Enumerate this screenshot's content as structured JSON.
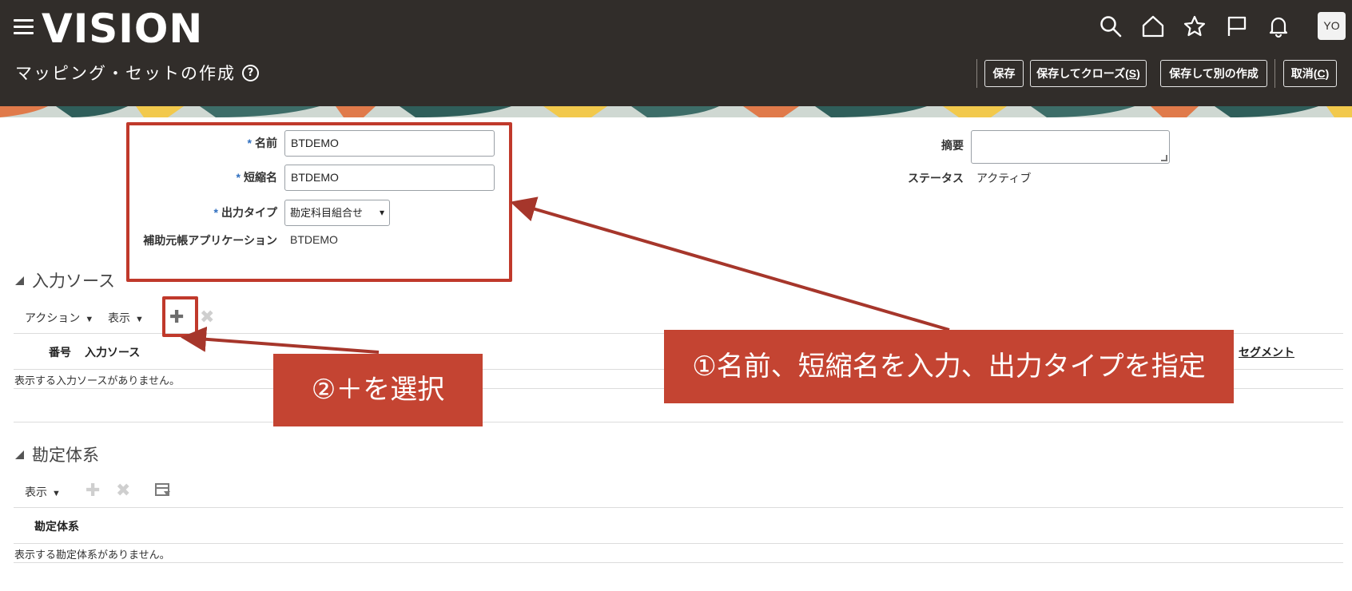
{
  "app": {
    "logo": "VISION",
    "page_title": "マッピング・セットの作成",
    "help_icon": "?",
    "user_initials": "YO"
  },
  "header_icons": [
    "search-icon",
    "home-icon",
    "star-icon",
    "flag-icon",
    "bell-icon"
  ],
  "toolbar": {
    "save": "保存",
    "save_close_prefix": "保存してクローズ(",
    "save_close_key": "S",
    "save_close_suffix": ")",
    "save_new": "保存して別の作成",
    "cancel_prefix": "取消(",
    "cancel_key": "C",
    "cancel_suffix": ")"
  },
  "form": {
    "required_mark": "*",
    "name_label": "名前",
    "name_value": "BTDEMO",
    "short_name_label": "短縮名",
    "short_name_value": "BTDEMO",
    "output_type_label": "出力タイプ",
    "output_type_value": "勘定科目組合せ",
    "subledger_label": "補助元帳アプリケーション",
    "subledger_value": "BTDEMO",
    "description_label": "摘要",
    "description_value": "",
    "status_label": "ステータス",
    "status_value": "アクティブ"
  },
  "input_sources": {
    "title": "入力ソース",
    "actions_label": "アクション",
    "view_label": "表示",
    "col_number": "番号",
    "col_source": "入力ソース",
    "col_segment": "セグメント",
    "empty_message": "表示する入力ソースがありません。"
  },
  "chart_of_accounts": {
    "title": "勘定体系",
    "view_label": "表示",
    "col_coa": "勘定体系",
    "empty_message": "表示する勘定体系がありません。"
  },
  "annotations": {
    "callout1": "①名前、短縮名を入力、出力タイプを指定",
    "callout2": "②＋を選択",
    "color": "#c44432"
  }
}
